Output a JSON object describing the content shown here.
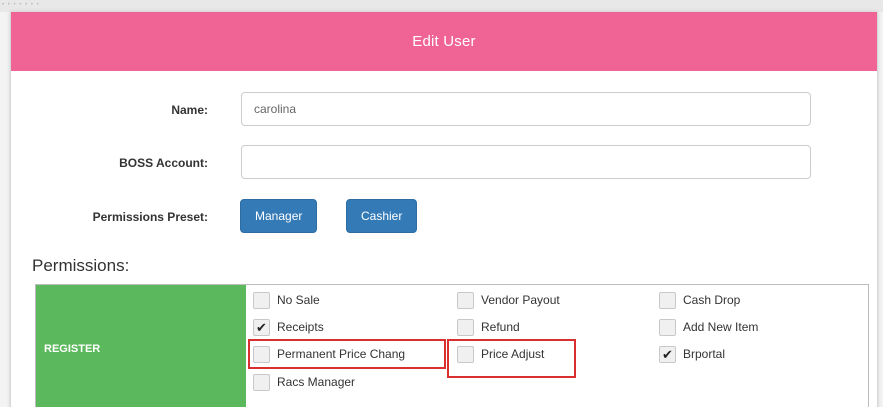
{
  "dialog": {
    "title": "Edit User"
  },
  "form": {
    "name_label": "Name:",
    "name_value": "carolina",
    "boss_label": "BOSS Account:",
    "boss_value": "",
    "preset_label": "Permissions Preset:",
    "presets": [
      {
        "label": "Manager"
      },
      {
        "label": "Cashier"
      }
    ]
  },
  "permissions": {
    "heading": "Permissions:",
    "groups": [
      {
        "name": "REGISTER",
        "items": [
          {
            "label": "No Sale",
            "checked": false
          },
          {
            "label": "Vendor Payout",
            "checked": false
          },
          {
            "label": "Cash Drop",
            "checked": false
          },
          {
            "label": "Receipts",
            "checked": true
          },
          {
            "label": "Refund",
            "checked": false
          },
          {
            "label": "Add New Item",
            "checked": false
          },
          {
            "label": "Permanent Price Chang",
            "checked": false
          },
          {
            "label": "Price Adjust",
            "checked": false
          },
          {
            "label": "Brportal",
            "checked": true
          },
          {
            "label": "Racs Manager",
            "checked": false
          }
        ]
      }
    ]
  },
  "colors": {
    "header": "#ef6395",
    "primary_button": "#337ab7",
    "group_label_bg": "#5cb85c",
    "highlight_box": "#d9302f"
  },
  "icons": {
    "checkmark": "checkmark-icon"
  }
}
